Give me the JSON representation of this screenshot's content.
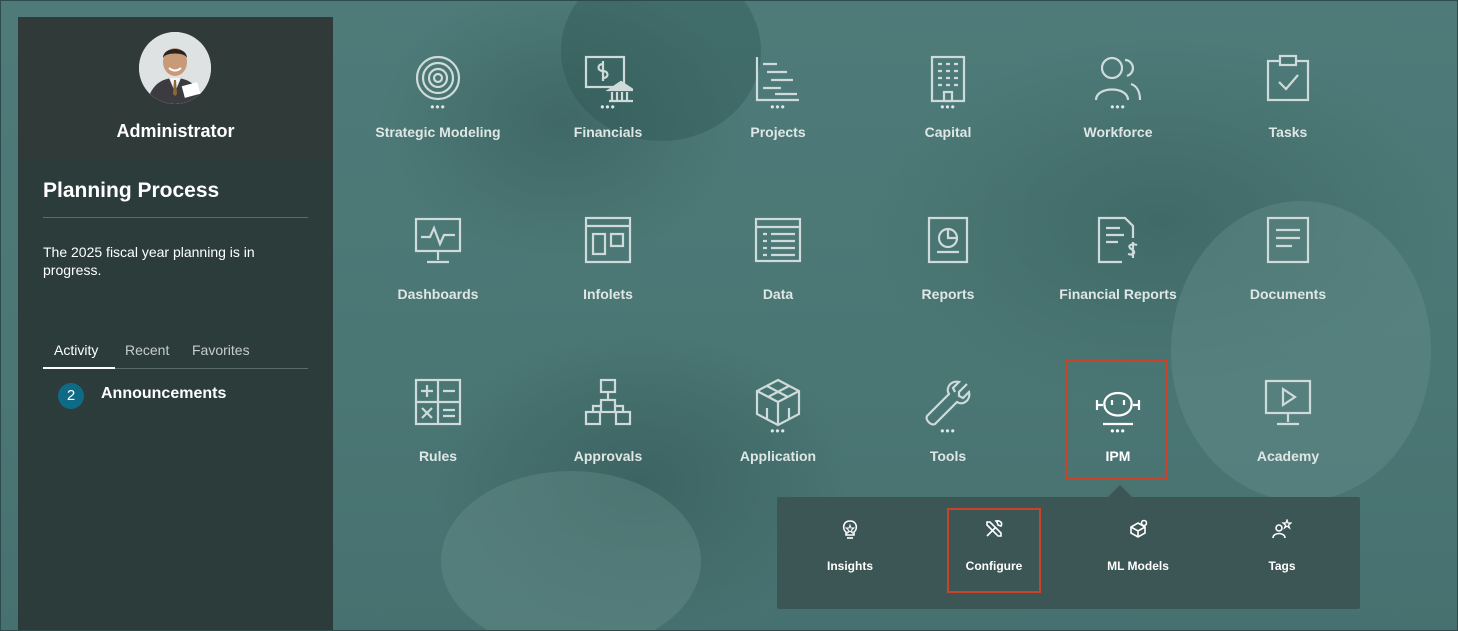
{
  "profile": {
    "name": "Administrator"
  },
  "sidebar": {
    "title": "Planning Process",
    "description": "The 2025 fiscal year planning is in progress.",
    "tabs": [
      {
        "label": "Activity",
        "active": true
      },
      {
        "label": "Recent",
        "active": false
      },
      {
        "label": "Favorites",
        "active": false
      }
    ],
    "announcements": {
      "count": "2",
      "label": "Announcements"
    }
  },
  "tiles": [
    {
      "label": "Strategic Modeling",
      "icon": "target-icon",
      "dots": true
    },
    {
      "label": "Financials",
      "icon": "financials-icon",
      "dots": true
    },
    {
      "label": "Projects",
      "icon": "projects-icon",
      "dots": true
    },
    {
      "label": "Capital",
      "icon": "building-icon",
      "dots": true
    },
    {
      "label": "Workforce",
      "icon": "people-icon",
      "dots": true
    },
    {
      "label": "Tasks",
      "icon": "clipboard-check-icon",
      "dots": false
    },
    {
      "label": "Dashboards",
      "icon": "monitor-pulse-icon",
      "dots": false
    },
    {
      "label": "Infolets",
      "icon": "infolets-icon",
      "dots": false
    },
    {
      "label": "Data",
      "icon": "data-grid-icon",
      "dots": false
    },
    {
      "label": "Reports",
      "icon": "report-chart-icon",
      "dots": false
    },
    {
      "label": "Financial Reports",
      "icon": "financial-report-icon",
      "dots": false
    },
    {
      "label": "Documents",
      "icon": "document-icon",
      "dots": false
    },
    {
      "label": "Rules",
      "icon": "calculator-icon",
      "dots": false
    },
    {
      "label": "Approvals",
      "icon": "hierarchy-icon",
      "dots": false
    },
    {
      "label": "Application",
      "icon": "cube-icon",
      "dots": true
    },
    {
      "label": "Tools",
      "icon": "wrench-icon",
      "dots": true
    },
    {
      "label": "IPM",
      "icon": "robot-icon",
      "dots": true
    },
    {
      "label": "Academy",
      "icon": "play-screen-icon",
      "dots": false
    }
  ],
  "dots_text": "•••",
  "ipm_menu": [
    {
      "label": "Insights",
      "icon": "lightbulb-icon"
    },
    {
      "label": "Configure",
      "icon": "tools-icon"
    },
    {
      "label": "ML Models",
      "icon": "ml-models-icon"
    },
    {
      "label": "Tags",
      "icon": "tags-icon"
    }
  ],
  "colors": {
    "highlight": "#c9432b",
    "badge": "#0f6a86",
    "sidebar": "#2c3c3b"
  }
}
